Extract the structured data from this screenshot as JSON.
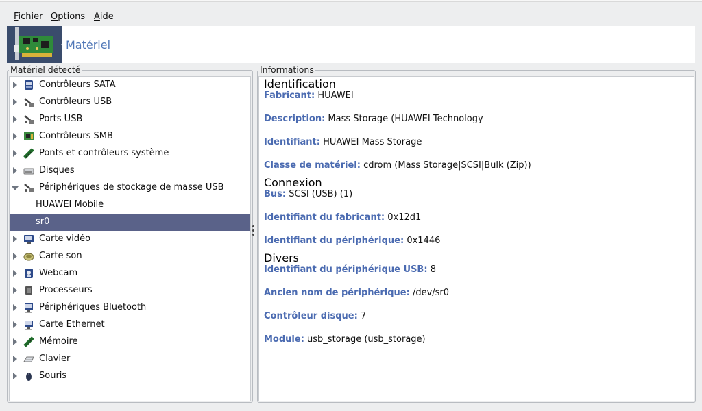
{
  "menu": [
    {
      "id": "fichier",
      "first": "F",
      "rest": "ichier"
    },
    {
      "id": "options",
      "first": "O",
      "rest": "ptions"
    },
    {
      "id": "aide",
      "first": "A",
      "rest": "ide"
    }
  ],
  "header": {
    "title": "Matériel"
  },
  "left_panel": {
    "label": "Matériel détecté",
    "items": [
      {
        "label": "Contrôleurs SATA",
        "icon": "sata-controller-icon",
        "expander": "closed",
        "selected": false
      },
      {
        "label": "Contrôleurs USB",
        "icon": "usb-controller-icon",
        "expander": "closed",
        "selected": false
      },
      {
        "label": "Ports USB",
        "icon": "usb-port-icon",
        "expander": "closed",
        "selected": false
      },
      {
        "label": "Contrôleurs SMB",
        "icon": "smb-controller-icon",
        "expander": "closed",
        "selected": false
      },
      {
        "label": "Ponts et contrôleurs système",
        "icon": "system-bridge-icon",
        "expander": "closed",
        "selected": false
      },
      {
        "label": "Disques",
        "icon": "disk-icon",
        "expander": "closed",
        "selected": false
      },
      {
        "label": "Périphériques de stockage de masse USB",
        "icon": "usb-storage-icon",
        "expander": "open",
        "selected": false
      },
      {
        "label": "HUAWEI Mobile",
        "icon": "",
        "expander": "none",
        "selected": false
      },
      {
        "label": "sr0",
        "icon": "",
        "expander": "none",
        "selected": true
      },
      {
        "label": "Carte vidéo",
        "icon": "video-card-icon",
        "expander": "closed",
        "selected": false
      },
      {
        "label": "Carte son",
        "icon": "sound-card-icon",
        "expander": "closed",
        "selected": false
      },
      {
        "label": "Webcam",
        "icon": "webcam-icon",
        "expander": "closed",
        "selected": false
      },
      {
        "label": "Processeurs",
        "icon": "processor-icon",
        "expander": "closed",
        "selected": false
      },
      {
        "label": "Périphériques Bluetooth",
        "icon": "bluetooth-device-icon",
        "expander": "closed",
        "selected": false
      },
      {
        "label": "Carte Ethernet",
        "icon": "ethernet-card-icon",
        "expander": "closed",
        "selected": false
      },
      {
        "label": "Mémoire",
        "icon": "memory-icon",
        "expander": "closed",
        "selected": false
      },
      {
        "label": "Clavier",
        "icon": "keyboard-icon",
        "expander": "closed",
        "selected": false
      },
      {
        "label": "Souris",
        "icon": "mouse-icon",
        "expander": "closed",
        "selected": false
      }
    ]
  },
  "right_panel": {
    "label": "Informations",
    "sections": [
      {
        "title": "Identification",
        "fields": [
          {
            "key": "Fabricant:",
            "value": "HUAWEI"
          },
          {
            "key": "Description:",
            "value": "Mass Storage (HUAWEI Technology"
          },
          {
            "key": "Identifiant:",
            "value": "HUAWEI Mass Storage"
          },
          {
            "key": "Classe de matériel:",
            "value": "cdrom (Mass Storage|SCSI|Bulk (Zip))"
          }
        ]
      },
      {
        "title": "Connexion",
        "fields": [
          {
            "key": "Bus:",
            "value": "SCSI (USB) (1)"
          },
          {
            "key": "Identifiant du fabricant:",
            "value": "0x12d1"
          },
          {
            "key": "Identifiant du périphérique:",
            "value": "0x1446"
          }
        ]
      },
      {
        "title": "Divers",
        "fields": [
          {
            "key": "Identifiant du périphérique USB:",
            "value": "8"
          },
          {
            "key": "Ancien nom de périphérique:",
            "value": "/dev/sr0"
          },
          {
            "key": "Contrôleur disque:",
            "value": "7"
          },
          {
            "key": "Module:",
            "value": "usb_storage (usb_storage)"
          }
        ]
      }
    ]
  },
  "colors": {
    "accent": "#5077b7",
    "selection": "#5a6289",
    "field_key": "#4b6bb1"
  }
}
